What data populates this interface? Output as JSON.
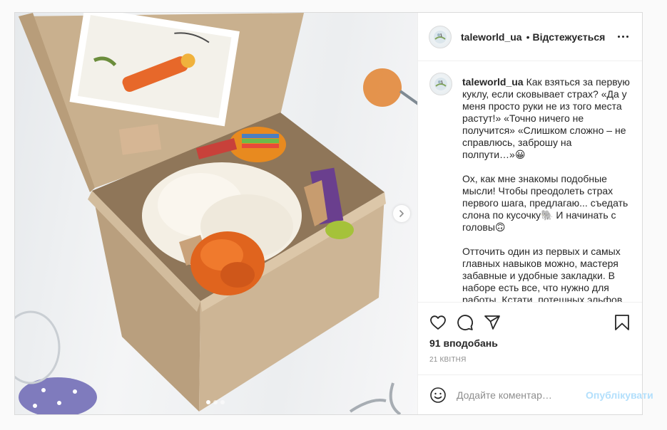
{
  "post": {
    "username": "taleworld_ua",
    "separator": "•",
    "follow_label": "Відстежується",
    "caption": "Как взяться за первую куклу, если сковывает страх? «Да у меня просто руки не из того места растут!» «Точно ничего не получится» «Слишком сложно – не справлюсь, заброшу на полпути…»😀\n\nОх, как мне знакомы подобные мысли! Чтобы преодолеть страх первого шага, предлагаю... съедать слона по кусочку🐘 И начинать с головы🙃\n\nОтточить один из первых и самых главных навыков можно, мастеря забавные и удобные закладки. В наборе есть все, что нужно для работы. Кстати, потешных эльфов обязательно",
    "likes": "91 вподобань",
    "date": "21 КВІТНЯ",
    "comment_placeholder": "Додайте коментар…",
    "post_button": "Опублікувати"
  },
  "carousel": {
    "slide_count": 3,
    "active_index": 0
  },
  "icons": {
    "like": "heart-icon",
    "comment": "comment-icon",
    "share": "share-icon",
    "save": "bookmark-icon",
    "more": "more-options-icon",
    "emoji": "emoji-icon",
    "next": "chevron-right-icon"
  },
  "colors": {
    "post_button_disabled": "#b2dffc",
    "secondary_text": "#8e8e8e",
    "border": "#dbdbdb"
  }
}
